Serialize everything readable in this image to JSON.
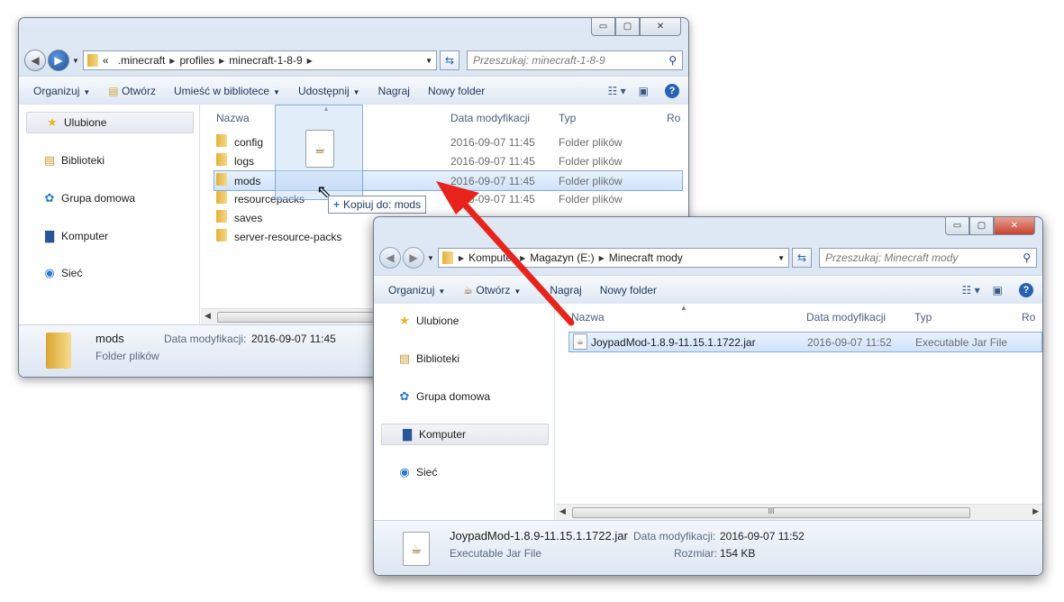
{
  "window_back": {
    "caption_buttons": {
      "min": "▭",
      "max": "▢",
      "close": "✕"
    },
    "address": {
      "overflow": "«",
      "segments": [
        ".minecraft",
        "profiles",
        "minecraft-1-8-9"
      ]
    },
    "search_placeholder": "Przeszukaj: minecraft-1-8-9",
    "toolbar": {
      "organize": "Organizuj",
      "open": "Otwórz",
      "library": "Umieść w bibliotece",
      "share": "Udostępnij",
      "burn": "Nagraj",
      "new_folder": "Nowy folder"
    },
    "nav": {
      "favorites": "Ulubione",
      "libraries": "Biblioteki",
      "homegroup": "Grupa domowa",
      "computer": "Komputer",
      "network": "Sieć"
    },
    "columns": {
      "name": "Nazwa",
      "date": "Data modyfikacji",
      "type": "Typ",
      "size": "Ro"
    },
    "rows": [
      {
        "name": "config",
        "date": "2016-09-07 11:45",
        "type": "Folder plików"
      },
      {
        "name": "logs",
        "date": "2016-09-07 11:45",
        "type": "Folder plików"
      },
      {
        "name": "mods",
        "date": "2016-09-07 11:45",
        "type": "Folder plików"
      },
      {
        "name": "resourcepacks",
        "date": "2016-09-07 11:45",
        "type": "Folder plików"
      },
      {
        "name": "saves",
        "date": "",
        "type": ""
      },
      {
        "name": "server-resource-packs",
        "date": "",
        "type": ""
      }
    ],
    "drag_tooltip": "Kopiuj do: mods",
    "details": {
      "name": "mods",
      "date_label": "Data modyfikacji:",
      "date": "2016-09-07 11:45",
      "type": "Folder plików"
    }
  },
  "window_front": {
    "caption_buttons": {
      "min": "▭",
      "max": "▢",
      "close": "✕"
    },
    "address": {
      "segments": [
        "Komputer",
        "Magazyn (E:)",
        "Minecraft mody"
      ]
    },
    "search_placeholder": "Przeszukaj: Minecraft mody",
    "toolbar": {
      "organize": "Organizuj",
      "open": "Otwórz",
      "burn": "Nagraj",
      "new_folder": "Nowy folder"
    },
    "nav": {
      "favorites": "Ulubione",
      "libraries": "Biblioteki",
      "homegroup": "Grupa domowa",
      "computer": "Komputer",
      "network": "Sieć"
    },
    "columns": {
      "name": "Nazwa",
      "date": "Data modyfikacji",
      "type": "Typ",
      "size": "Ro"
    },
    "rows": [
      {
        "name": "JoypadMod-1.8.9-11.15.1.1722.jar",
        "date": "2016-09-07 11:52",
        "type": "Executable Jar File"
      }
    ],
    "scroll_grip": "III",
    "details": {
      "name": "JoypadMod-1.8.9-11.15.1.1722.jar",
      "date_label": "Data modyfikacji:",
      "date": "2016-09-07 11:52",
      "type": "Executable Jar File",
      "size_label": "Rozmiar:",
      "size": "154 KB"
    }
  },
  "annotation": {
    "color": "#e8231c"
  }
}
